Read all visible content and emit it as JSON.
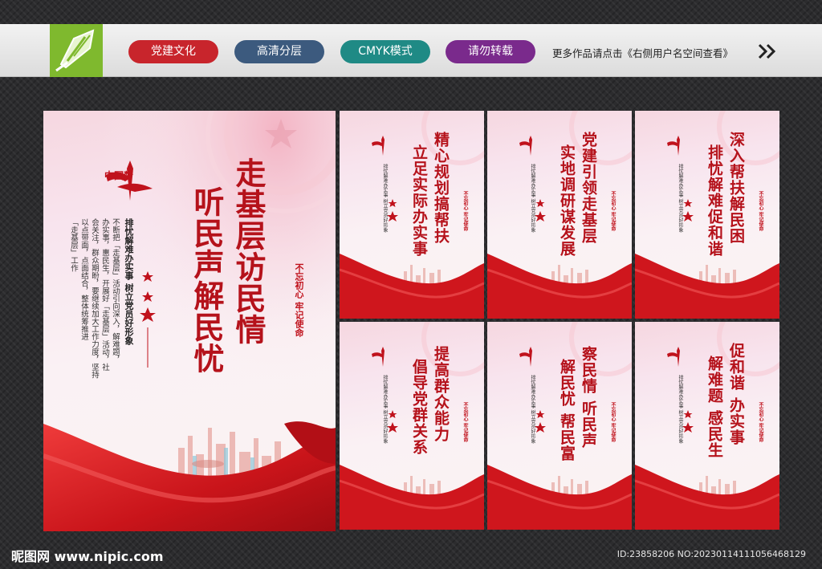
{
  "topbar": {
    "tags": [
      {
        "label": "党建文化",
        "color": "#c8252c"
      },
      {
        "label": "高清分层",
        "color": "#3c5a7e"
      },
      {
        "label": "CMYK模式",
        "color": "#1f8a85"
      },
      {
        "label": "请勿转载",
        "color": "#7a2a8c"
      }
    ],
    "more_text": "更多作品请点击《右侧用户名空间查看》",
    "arrow_icon": "double-chevron-right-icon",
    "logo_icon": "pen-nib-logo-icon"
  },
  "main_poster": {
    "title_col1": "走基层访民情",
    "title_col2": "听民声解民忧",
    "stamp": "不忘初心 牢记使命",
    "subtitle": "排忧解难办实事  树立党员好形象",
    "body": [
      "不断把「走基层」活动引向深入，解难题，",
      "办实事，惠民生，开展好「走基层」活动，社",
      "会关注，群众期盼，要继续加大工作力度，坚持",
      "以点带面，点面结合，整体统筹推进",
      "「走基层」工作"
    ],
    "emblem": "中国梦"
  },
  "small_posters": [
    {
      "col1": "精心规划搞帮扶",
      "col2": "立足实际办实事"
    },
    {
      "col1": "党建引领走基层",
      "col2": "实地调研谋发展"
    },
    {
      "col1": "深入帮扶解民困",
      "col2": "排忧解难促和谐"
    },
    {
      "col1": "提高群众能力",
      "col2": "倡导党群关系"
    },
    {
      "col1": "察民情 听民声",
      "col2": "解民忧 帮民富"
    },
    {
      "col1": "促和谐 办实事",
      "col2": "解难题 感民生"
    }
  ],
  "small_common": {
    "stamp": "不忘初心 牢记使命",
    "subtitle": "排忧解难办实事  树立党员好形象"
  },
  "footer": {
    "site": "昵图网 www.nipic.com",
    "id": "ID:23858206 NO:20230114111056468129"
  },
  "colors": {
    "party_red": "#c0121c",
    "ribbon_red": "#d91e24",
    "title_red": "#b5121b"
  }
}
